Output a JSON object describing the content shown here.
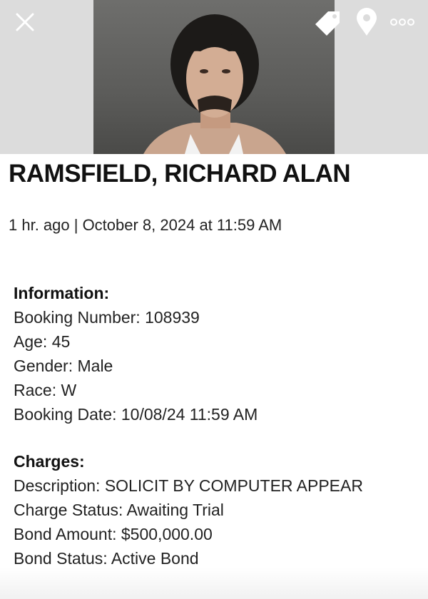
{
  "header": {
    "icons": [
      "close-icon",
      "tag-icon",
      "location-pin-icon",
      "more-icon"
    ],
    "colors": {
      "bar": "#dcdcdc",
      "icon": "#ffffff"
    }
  },
  "profile": {
    "name": "RAMSFIELD, RICHARD ALAN",
    "meta": "1 hr. ago | October 8, 2024 at 11:59 AM"
  },
  "information": {
    "heading": "Information:",
    "lines": [
      "Booking Number: 108939",
      "Age: 45",
      "Gender: Male",
      "Race: W",
      "Booking Date: 10/08/24 11:59 AM"
    ]
  },
  "charges": {
    "heading": "Charges:",
    "lines": [
      "Description: SOLICIT BY COMPUTER APPEAR",
      "Charge Status: Awaiting Trial",
      "Bond Amount: $500,000.00",
      "Bond Status: Active Bond"
    ]
  }
}
